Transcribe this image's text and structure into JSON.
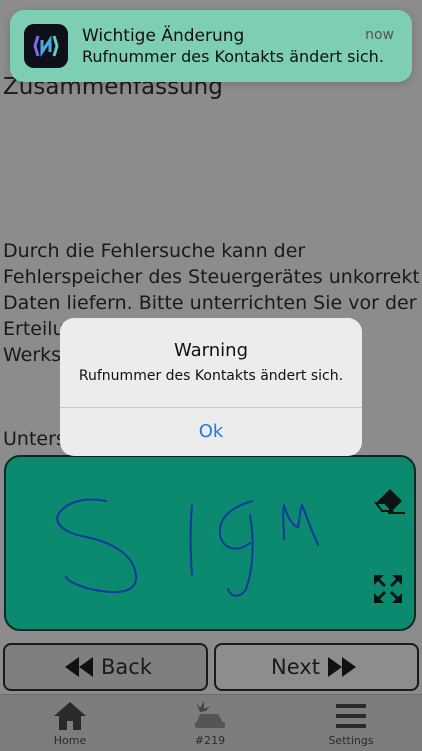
{
  "content": {
    "title": "Zusammenfassung",
    "body_lines": [
      "Durch die Fehlersuche kann der",
      "Fehlerspeicher des Steuergerätes unkorrekte",
      "Daten liefern. Bitte unterrichten Sie vor der",
      "Erteilu",
      "Werkst"
    ],
    "signature_label": "Unters"
  },
  "signature_pad": {
    "background": "#0c8a70",
    "eraser_icon": "eraser-icon",
    "expand_icon": "expand-icon"
  },
  "nav": {
    "back_label": "Back",
    "next_label": "Next"
  },
  "tabbar": {
    "items": [
      {
        "label": "Home",
        "icon": "home-icon"
      },
      {
        "label": "#219",
        "icon": "car-crash-icon"
      },
      {
        "label": "Settings",
        "icon": "menu-icon"
      }
    ]
  },
  "notification": {
    "title": "Wichtige Änderung",
    "message": "Rufnummer des Kontakts ändert sich.",
    "time": "now",
    "accent": "#7ecdb5"
  },
  "alert": {
    "title": "Warning",
    "message": "Rufnummer des Kontakts ändert sich.",
    "button": "Ok",
    "button_color": "#1f7ae6"
  }
}
